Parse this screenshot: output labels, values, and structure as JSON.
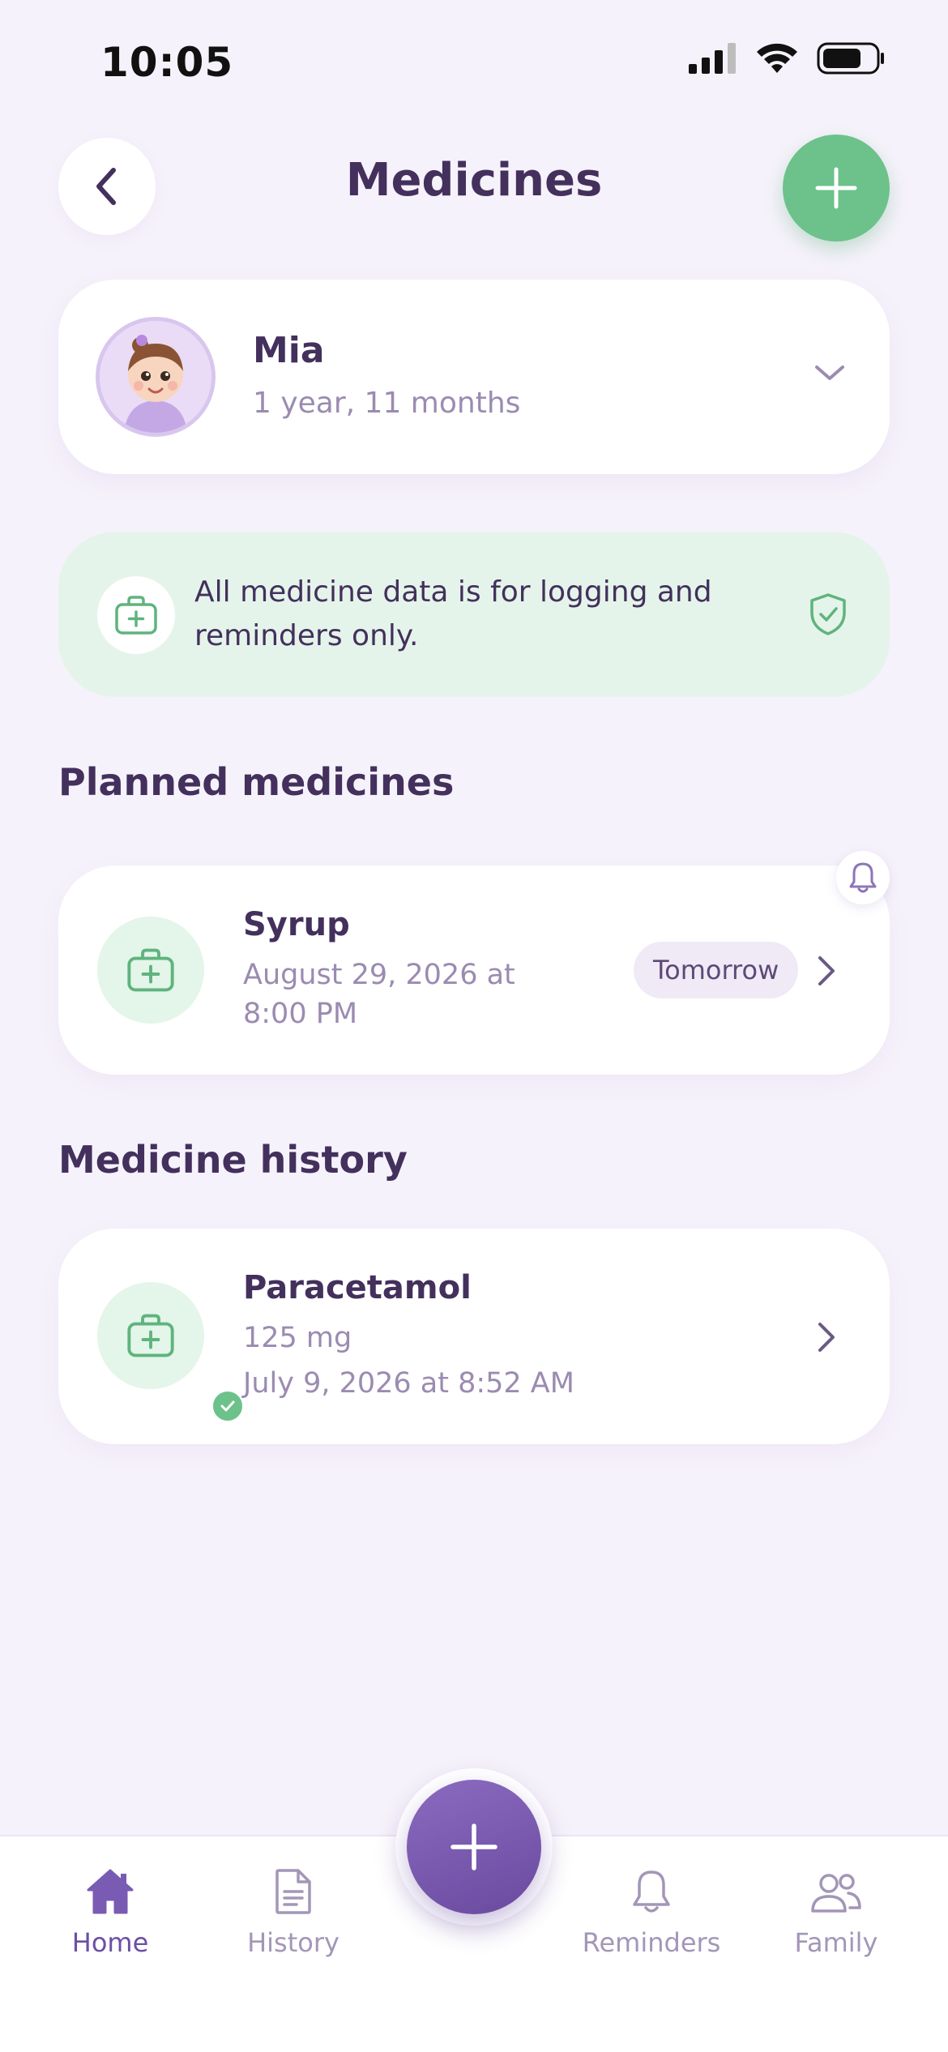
{
  "status_bar": {
    "time": "10:05"
  },
  "header": {
    "title": "Medicines"
  },
  "child": {
    "name": "Mia",
    "age": "1 year, 11 months"
  },
  "info_banner": {
    "text": "All medicine data is for logging and reminders only."
  },
  "planned": {
    "section_title": "Planned medicines",
    "items": [
      {
        "name": "Syrup",
        "datetime_line1": "August 29, 2026 at",
        "datetime_line2": "8:00 PM",
        "badge": "Tomorrow"
      }
    ]
  },
  "history": {
    "section_title": "Medicine history",
    "items": [
      {
        "name": "Paracetamol",
        "dose": "125 mg",
        "datetime": "July 9, 2026 at 8:52 AM"
      }
    ]
  },
  "bottom_nav": {
    "items": [
      {
        "label": "Home",
        "icon": "home-icon",
        "active": true
      },
      {
        "label": "History",
        "icon": "document-icon",
        "active": false
      },
      {
        "label": "Reminders",
        "icon": "bell-icon",
        "active": false
      },
      {
        "label": "Family",
        "icon": "people-icon",
        "active": false
      }
    ]
  },
  "colors": {
    "background": "#f6f2fb",
    "primary_purple": "#6c4fa6",
    "accent_green": "#6cc28a",
    "banner_green": "#e5f4ea",
    "title_text": "#43305c",
    "muted_text": "#9b8bb1"
  }
}
